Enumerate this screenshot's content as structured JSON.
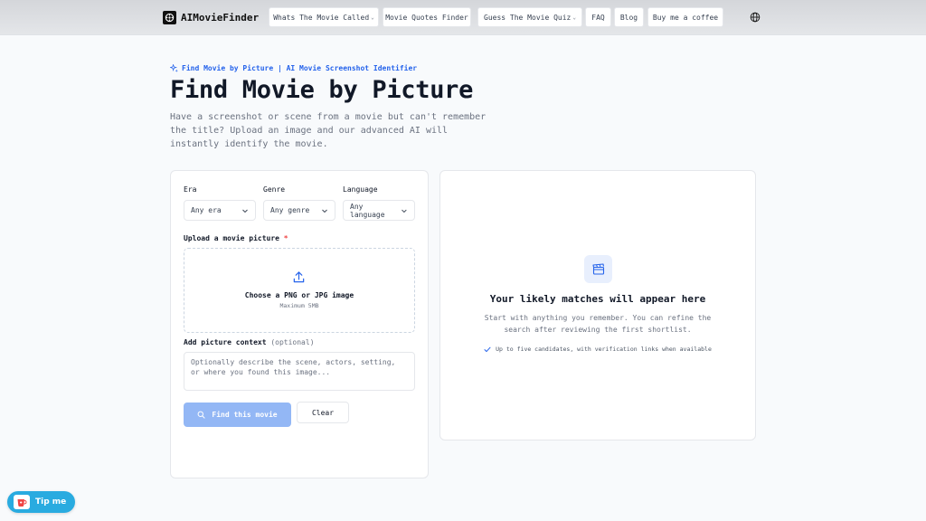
{
  "brand": {
    "name": "AIMovieFinder",
    "logo_icon": "film-reel-logo-icon"
  },
  "nav": {
    "items": [
      {
        "label": "Whats The Movie Called",
        "has_dropdown": true
      },
      {
        "label": "Movie Quotes Finder",
        "has_dropdown": false
      },
      {
        "label": "Guess The Movie Quiz",
        "has_dropdown": true
      },
      {
        "label": "FAQ",
        "has_dropdown": false
      },
      {
        "label": "Blog",
        "has_dropdown": false
      },
      {
        "label": "Buy me a coffee",
        "has_dropdown": false
      }
    ],
    "language_icon": "globe-icon"
  },
  "hero": {
    "eyebrow": "Find Movie by Picture | AI Movie Screenshot Identifier",
    "eyebrow_icon": "sparkle-icon",
    "title": "Find Movie by Picture",
    "subtitle": "Have a screenshot or scene from a movie but can't remember the title? Upload an image and our advanced AI will instantly identify the movie."
  },
  "form": {
    "filters": [
      {
        "label": "Era",
        "value": "Any era"
      },
      {
        "label": "Genre",
        "value": "Any genre"
      },
      {
        "label": "Language",
        "value": "Any language"
      }
    ],
    "upload": {
      "label": "Upload a movie picture",
      "required_mark": "*",
      "title": "Choose a PNG or JPG image",
      "subtitle": "Maximum 5MB",
      "icon": "upload-icon"
    },
    "context": {
      "label": "Add picture context",
      "optional": "(optional)",
      "placeholder": "Optionally describe the scene, actors, setting, or where you found this image...",
      "value": ""
    },
    "find_button": "Find this movie",
    "clear_button": "Clear"
  },
  "results": {
    "icon": "clapperboard-icon",
    "title": "Your likely matches will appear here",
    "description": "Start with anything you remember. You can refine the search after reviewing the first shortlist.",
    "note": "Up to five candidates, with verification links when available"
  },
  "tip": {
    "label": "Tip me",
    "icon": "coffee-cup-icon"
  },
  "colors": {
    "accent": "#2563eb",
    "find_button_bg": "#93b7f5",
    "tip_button_bg": "#29abe0",
    "required": "#ef4444"
  }
}
